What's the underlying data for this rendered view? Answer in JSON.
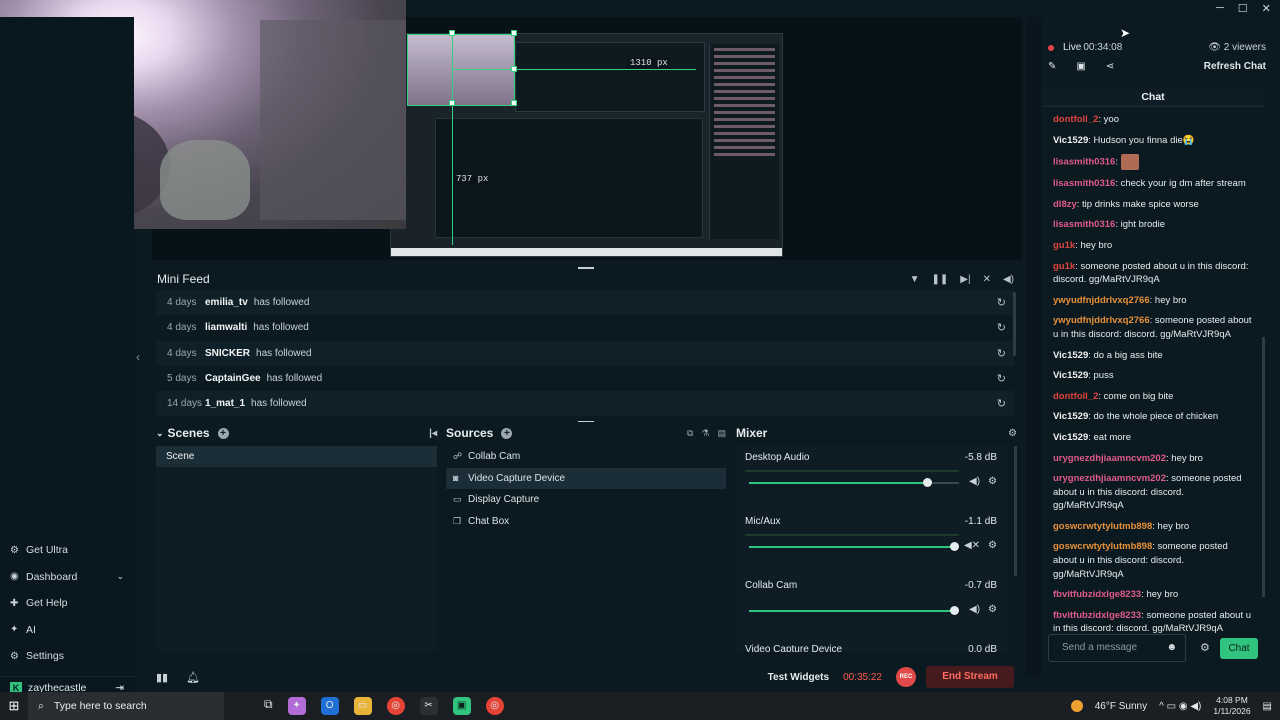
{
  "window": {
    "controls": [
      "─",
      "☐",
      "✕"
    ],
    "expand_glyph": "›"
  },
  "nav": {
    "items": [
      {
        "label": "Get Ultra",
        "icon": "ultra-icon"
      },
      {
        "label": "Dashboard",
        "icon": "dashboard-icon"
      },
      {
        "label": "Get Help",
        "icon": "help-icon"
      },
      {
        "label": "AI",
        "icon": "ai-icon"
      },
      {
        "label": "Settings",
        "icon": "gear-icon"
      }
    ],
    "user": {
      "name": "zaythecastle",
      "badge": "K"
    }
  },
  "preview": {
    "width_label": "1310 px",
    "height_label": "737 px"
  },
  "minifeed": {
    "title": "Mini Feed",
    "rows": [
      {
        "when": "4 days",
        "who": "emilia_tv",
        "action": "has followed"
      },
      {
        "when": "4 days",
        "who": "liamwalti",
        "action": "has followed"
      },
      {
        "when": "4 days",
        "who": "SNICKER",
        "action": "has followed"
      },
      {
        "when": "5 days",
        "who": "CaptainGee",
        "action": "has followed"
      },
      {
        "when": "14 days",
        "who": "1_mat_1",
        "action": "has followed"
      }
    ]
  },
  "scenes": {
    "title": "Scenes",
    "items": [
      "Scene"
    ]
  },
  "sources": {
    "title": "Sources",
    "items": [
      "Collab Cam",
      "Video Capture Device",
      "Display Capture",
      "Chat Box"
    ],
    "selected_index": 1
  },
  "mixer": {
    "title": "Mixer",
    "channels": [
      {
        "name": "Desktop Audio",
        "db": "-5.8 dB",
        "level": 0.85
      },
      {
        "name": "Mic/Aux",
        "db": "-1.1 dB",
        "level": 0.98
      },
      {
        "name": "Collab Cam",
        "db": "-0.7 dB",
        "level": 0.98
      },
      {
        "name": "Video Capture Device",
        "db": "0.0 dB",
        "level": 1.0
      }
    ]
  },
  "statusbar": {
    "test_widgets": "Test Widgets",
    "timer": "00:35:22",
    "rec": "REC",
    "end_stream": "End Stream"
  },
  "live": {
    "label": "Live",
    "time": "00:34:08",
    "viewers": "2 viewers",
    "refresh": "Refresh Chat"
  },
  "chat": {
    "title": "Chat",
    "placeholder": "Send a message",
    "send": "Chat",
    "messages": [
      {
        "user": "dontfoll_2",
        "color": "#e0443c",
        "text": "yoo"
      },
      {
        "user": "Vic1529",
        "color": "#f0f0f0",
        "text": "Hudson you finna die😭"
      },
      {
        "user": "lisasmith0316",
        "color": "#e05a8a",
        "text": "",
        "emote": true
      },
      {
        "user": "lisasmith0316",
        "color": "#e05a8a",
        "text": "check your ig dm after stream"
      },
      {
        "user": "dl8zy",
        "color": "#e05a8a",
        "text": "tip drinks make spice worse"
      },
      {
        "user": "lisasmith0316",
        "color": "#e05a8a",
        "text": "ight brodie"
      },
      {
        "user": "gu1k",
        "color": "#e0443c",
        "text": "hey bro"
      },
      {
        "user": "gu1k",
        "color": "#e0443c",
        "text": "someone posted about u in this discord: discord. gg/MaRtVJR9qA"
      },
      {
        "user": "ywyudfnjddrlvxq2766",
        "color": "#e8913a",
        "text": "hey bro"
      },
      {
        "user": "ywyudfnjddrlvxq2766",
        "color": "#e8913a",
        "text": "someone posted about u in this discord: discord. gg/MaRtVJR9qA"
      },
      {
        "user": "Vic1529",
        "color": "#f0f0f0",
        "text": "do a big ass bite"
      },
      {
        "user": "Vic1529",
        "color": "#f0f0f0",
        "text": "puss"
      },
      {
        "user": "dontfoll_2",
        "color": "#e0443c",
        "text": "come on big bite"
      },
      {
        "user": "Vic1529",
        "color": "#f0f0f0",
        "text": "do the whole piece of chicken"
      },
      {
        "user": "Vic1529",
        "color": "#f0f0f0",
        "text": "eat more"
      },
      {
        "user": "urygnezdhjiaamncvm202",
        "color": "#e05a8a",
        "text": "hey bro"
      },
      {
        "user": "urygnezdhjiaamncvm202",
        "color": "#e05a8a",
        "text": "someone posted about u in this discord: discord. gg/MaRtVJR9qA"
      },
      {
        "user": "goswcrwtytylutmb898",
        "color": "#e8913a",
        "text": "hey bro"
      },
      {
        "user": "goswcrwtytylutmb898",
        "color": "#e8913a",
        "text": "someone posted about u in this discord: discord. gg/MaRtVJR9qA"
      },
      {
        "user": "fbvitfubzidxlge8233",
        "color": "#e05a8a",
        "text": "hey bro"
      },
      {
        "user": "fbvitfubzidxlge8233",
        "color": "#e05a8a",
        "text": "someone posted about u in this discord: discord. gg/MaRtVJR9qA"
      }
    ]
  },
  "taskbar": {
    "search_placeholder": "Type here to search",
    "weather": "46°F  Sunny",
    "time": "4:08 PM",
    "date": "1/11/2026"
  },
  "colors": {
    "accent": "#31c47f",
    "live": "#e24a4a",
    "end": "#ff6a5f"
  }
}
